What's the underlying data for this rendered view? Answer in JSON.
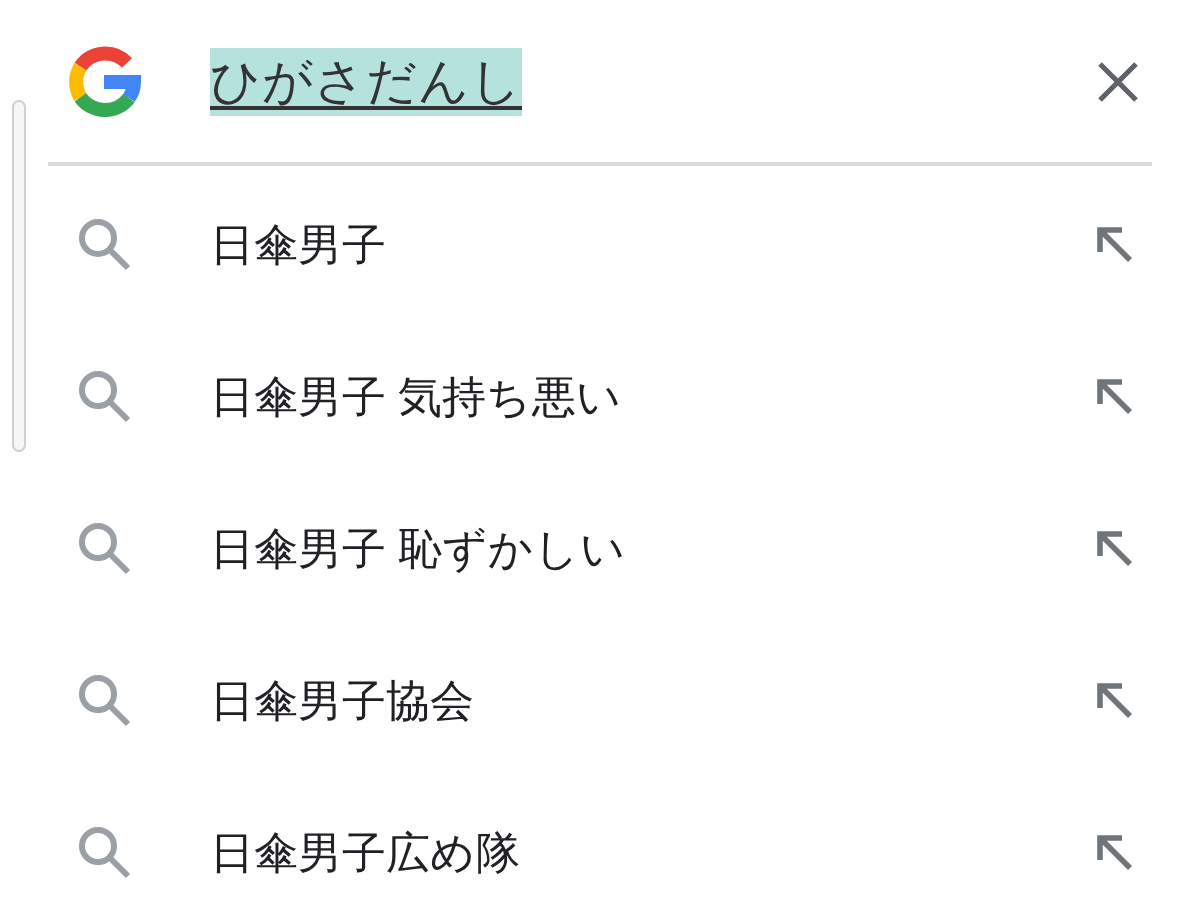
{
  "search": {
    "value": "ひがさだんし"
  },
  "suggestions": [
    {
      "text": "日傘男子"
    },
    {
      "text": "日傘男子 気持ち悪い"
    },
    {
      "text": "日傘男子 恥ずかしい"
    },
    {
      "text": "日傘男子協会"
    },
    {
      "text": "日傘男子広め隊"
    }
  ]
}
